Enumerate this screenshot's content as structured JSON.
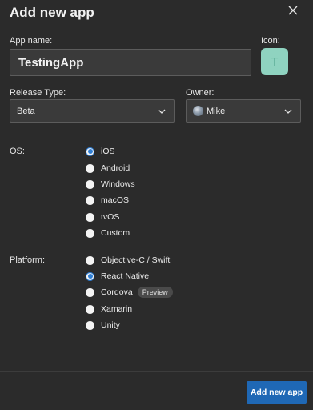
{
  "dialog": {
    "title": "Add new app"
  },
  "app_name": {
    "label": "App name:",
    "value": "TestingApp"
  },
  "icon": {
    "label": "Icon:",
    "letter": "T",
    "color": "#8fd3c0"
  },
  "release_type": {
    "label": "Release Type:",
    "selected": "Beta"
  },
  "owner": {
    "label": "Owner:",
    "selected": "Mike"
  },
  "os": {
    "label": "OS:",
    "options": [
      "iOS",
      "Android",
      "Windows",
      "macOS",
      "tvOS",
      "Custom"
    ],
    "selected": "iOS"
  },
  "platform": {
    "label": "Platform:",
    "options": [
      "Objective-C / Swift",
      "React Native",
      "Cordova",
      "Xamarin",
      "Unity"
    ],
    "selected": "React Native",
    "cordova_badge": "Preview"
  },
  "footer": {
    "submit_label": "Add new app"
  },
  "colors": {
    "background": "#2b2b2b",
    "accent": "#1f68b5",
    "radio_selected": "#2f7fd6"
  }
}
